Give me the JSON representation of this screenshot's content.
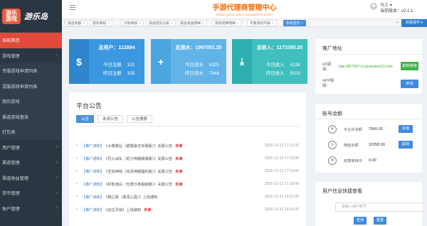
{
  "app": {
    "logo_badge": "游乐\n游戏",
    "logo_text": "游乐岛",
    "title": "手游代理商管理中心",
    "subtitle": "Mobile game agent management center"
  },
  "user": {
    "name": "马土",
    "version": "当前版本：v2.1.1"
  },
  "sidebar": {
    "items": [
      {
        "label": "系统首页",
        "active": true,
        "arrow": false
      },
      {
        "label": "游戏管理",
        "active": false,
        "arrow": true
      },
      {
        "label": "专服游戏申请列表",
        "active": false,
        "arrow": false,
        "child": true
      },
      {
        "label": "混服游戏申请列表",
        "active": false,
        "arrow": false,
        "child": true
      },
      {
        "label": "我的游戏",
        "active": false,
        "arrow": false,
        "child": true
      },
      {
        "label": "渠道游戏基准",
        "active": false,
        "arrow": false,
        "child": true
      },
      {
        "label": "打包表",
        "active": false,
        "arrow": false,
        "child": true
      },
      {
        "label": "用户管理",
        "active": false,
        "arrow": true
      },
      {
        "label": "渠道管理",
        "active": false,
        "arrow": true
      },
      {
        "label": "渠道收益管理",
        "active": false,
        "arrow": true
      },
      {
        "label": "货币管理",
        "active": false,
        "arrow": true
      },
      {
        "label": "账户管理",
        "active": false,
        "arrow": true
      }
    ]
  },
  "tabs": [
    {
      "label": "渠道余额",
      "active": false
    },
    {
      "label": "游戏审核",
      "active": false
    },
    {
      "label": "付款审核",
      "active": false
    },
    {
      "label": "渠道提现记录",
      "active": false
    },
    {
      "label": "渠道收益明细",
      "active": false
    },
    {
      "label": "游戏结算明细",
      "active": false
    },
    {
      "label": "专服游戏列表",
      "active": false
    },
    {
      "label": "系统首页",
      "active": true
    }
  ],
  "tab_operations": "标签操作",
  "stats": [
    {
      "title": "总用户：112894",
      "l1": "今日注册",
      "v1": "132",
      "l2": "昨日注册",
      "v2": "155",
      "color": "#3b98e0",
      "dark": "#2f86cc",
      "icon": "money-bag-icon"
    },
    {
      "title": "总流水：1997051.25",
      "l1": "今日流水",
      "v1": "6325",
      "l2": "昨日流水",
      "v2": "7348",
      "color": "#62b3e8",
      "dark": "#4aa5e0",
      "icon": "add-user-icon"
    },
    {
      "title": "总收入：1173395.20",
      "l1": "今日收入",
      "v1": "4138",
      "l2": "昨日收入",
      "v2": "5023",
      "color": "#3fc0bf",
      "dark": "#2eaeae",
      "icon": "download-icon"
    }
  ],
  "announcements": {
    "title": "平台公告",
    "tabs": [
      "公告",
      "未读公告",
      "公告搜索"
    ],
    "unread_label": "未读",
    "rows": [
      {
        "tag": "【推广通知】",
        "text": "《大秦霸业（碧霞暴击专服版）》关服公告",
        "unread": true,
        "date": "2025-12-12 17:21:00"
      },
      {
        "tag": "【推广通知】",
        "text": "《烈火战车（纸刀神器爆爆服）》关服公告",
        "unread": true,
        "date": "2025-12-12 17:19:00"
      },
      {
        "tag": "【推广通知】",
        "text": "《圣剑神域（双渍神器福利版）》关服公告",
        "unread": true,
        "date": "2025-12-12 17:19:00"
      },
      {
        "tag": "【推广通知】",
        "text": "《封影滴白（无限分身超越爆）》关服公告",
        "unread": true,
        "date": "2025-12-12 17:18:00"
      },
      {
        "tag": "【推广通知】",
        "text": "《横之歌（勇闯三国）》上线通知",
        "unread": false,
        "date": "2025-12-12 16:51:00"
      },
      {
        "tag": "【推广通知】",
        "text": "《远古灵域》上线通知",
        "unread": true,
        "date": "2025-12-12 14:33:00"
      }
    ]
  },
  "promo": {
    "title": "推广地址",
    "h5_label": "H5链\n接：",
    "h5_url": "http://827957.m.youledao123.com",
    "copy_button": "复制链接",
    "app_label": "APP链\n接：",
    "apply_button": "申请"
  },
  "balance": {
    "title": "账号余额",
    "rows": [
      {
        "icon": "yuan-icon",
        "glyph": "¥",
        "label": "平台币余额",
        "value": "7900.00",
        "button": "充值"
      },
      {
        "icon": "coin-icon",
        "glyph": "◎",
        "label": "佣金余额",
        "value": "32058.00",
        "button": "提现"
      },
      {
        "icon": "snowflake-icon",
        "glyph": "❄",
        "label": "结算审核中",
        "value": "0.00",
        "button": ""
      }
    ]
  },
  "query": {
    "title": "用户信息快捷查看",
    "placeholder": "请输入用户账号",
    "search_button": "查询",
    "reset_button": "重置"
  }
}
